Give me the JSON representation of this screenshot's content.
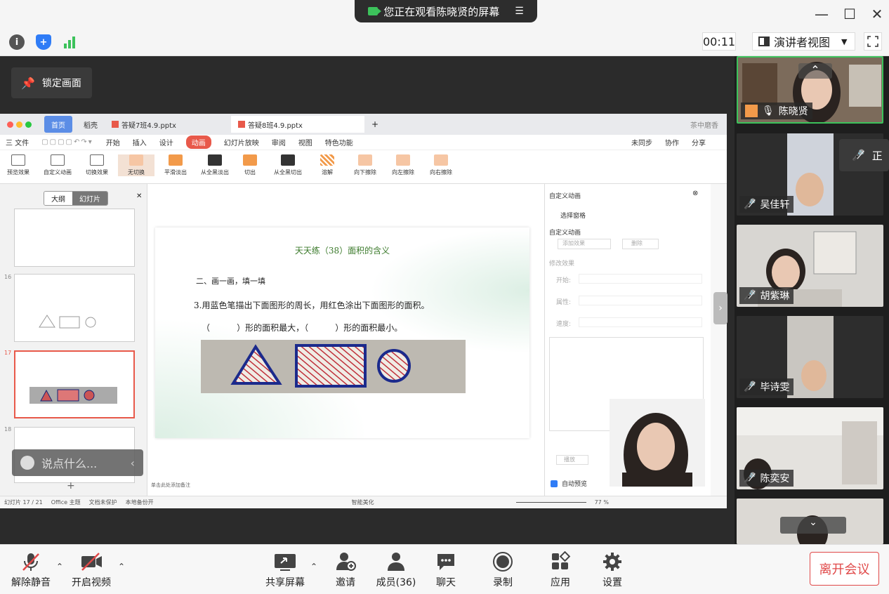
{
  "share_banner": {
    "text": "您正在观看陈晓贤的屏幕"
  },
  "timer": "00:11",
  "view_mode": "演讲者视图",
  "lock_screen_label": "锁定画面",
  "wps": {
    "tabs": [
      "首页",
      "稻壳",
      "答疑7班4.9.pptx",
      "答疑8班4.9.pptx"
    ],
    "tab_right": "茶中磨香",
    "menu": [
      "三 文件",
      "开始",
      "插入",
      "设计",
      "动画",
      "幻灯片放映",
      "审阅",
      "视图",
      "特色功能"
    ],
    "menu_right": [
      "未同步",
      "协作",
      "分享"
    ],
    "ribbon": [
      "预览效果",
      "自定义动画",
      "切换效果",
      "无切换",
      "平滑淡出",
      "从全黑淡出",
      "切出",
      "从全黑切出",
      "溶解",
      "向下擦除",
      "向左擦除",
      "向右擦除"
    ],
    "panel_tabs": [
      "大纲",
      "幻灯片"
    ],
    "slide_numbers": [
      "16",
      "17",
      "18"
    ],
    "slide": {
      "title": "天天练（38）面积的含义",
      "section": "二、画一画，填一填",
      "question": "3.用蓝色笔描出下面图形的周长，用红色涂出下面图形的面积。",
      "blank": "（          ）形的面积最大，（          ）形的面积最小。"
    },
    "notes_hint": "单击此处添加备注",
    "status": [
      "幻灯片 17 / 21",
      "Office 主题",
      "文档未保护",
      "本地备份开",
      "智能美化",
      "77 %"
    ],
    "anim_pane": {
      "title": "自定义动画",
      "select_pane": "选择窗格",
      "custom": "自定义动画",
      "add_effect": "添加效果",
      "delete": "删除",
      "modify": "修改效果",
      "start": "开始:",
      "property": "属性:",
      "speed": "速度:",
      "play": "播放",
      "auto_preview": "自动预览"
    }
  },
  "comment_placeholder": "说点什么...",
  "participants": [
    {
      "name": "陈晓贤",
      "muted": false
    },
    {
      "name": "吴佳轩",
      "muted": true
    },
    {
      "name": "胡紫琳",
      "muted": true
    },
    {
      "name": "毕诗雯",
      "muted": true
    },
    {
      "name": "陈奕安",
      "muted": true
    }
  ],
  "toast_text": "正",
  "bottom": {
    "unmute": "解除静音",
    "video": "开启视频",
    "share": "共享屏幕",
    "invite": "邀请",
    "members": "成员(36)",
    "chat": "聊天",
    "record": "录制",
    "apps": "应用",
    "settings": "设置",
    "leave": "离开会议"
  },
  "colors": {
    "accent_green": "#3cc25b",
    "leave_red": "#e04848",
    "wps_red": "#e8594a",
    "shield_blue": "#2f7cf6"
  }
}
